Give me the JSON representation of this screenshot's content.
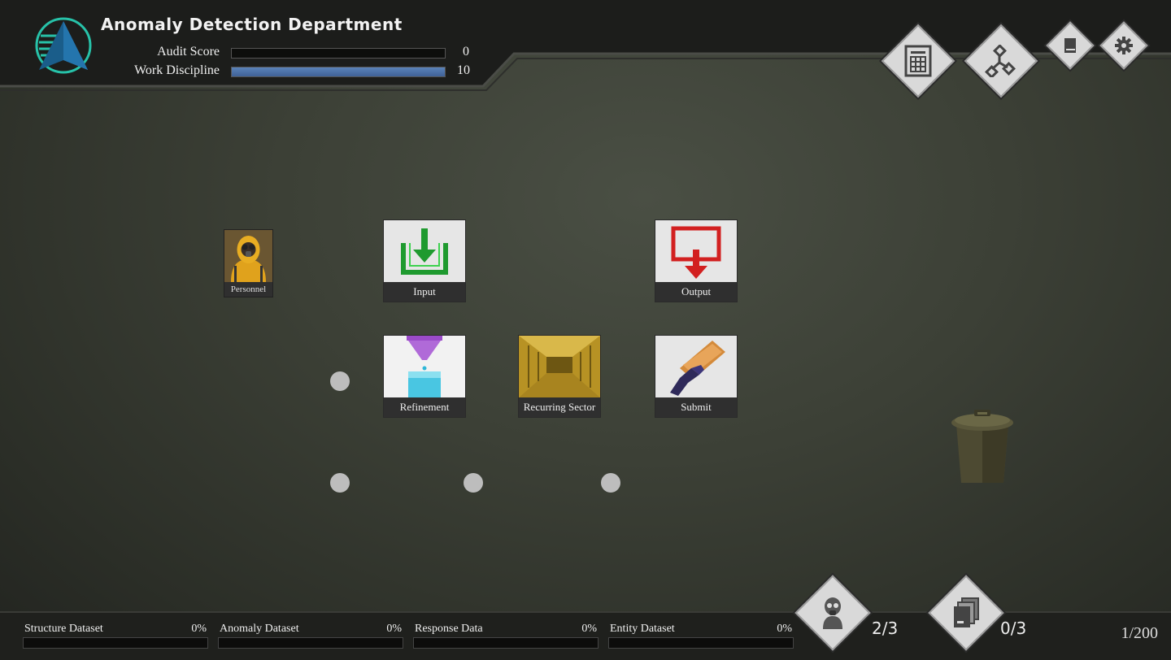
{
  "header": {
    "title": "Anomaly Detection Department",
    "stats": [
      {
        "label": "Audit Score",
        "value": "0",
        "fill": 0
      },
      {
        "label": "Work Discipline",
        "value": "10",
        "fill": 1
      }
    ]
  },
  "toolbar": {
    "buttons": [
      "document-grid-icon",
      "flowchart-icon",
      "book-icon",
      "gear-icon"
    ]
  },
  "board": {
    "personnel_label": "Personnel",
    "tiles": {
      "input": "Input",
      "output": "Output",
      "refinement": "Refinement",
      "recurring": "Recurring Sector",
      "submit": "Submit"
    }
  },
  "footer": {
    "datasets": [
      {
        "name": "Structure Dataset",
        "pct": "0%"
      },
      {
        "name": "Anomaly Dataset",
        "pct": "0%"
      },
      {
        "name": "Response Data",
        "pct": "0%"
      },
      {
        "name": "Entity Dataset",
        "pct": "0%"
      }
    ],
    "personnel_count": "2/3",
    "documents_count": "0/3",
    "page": "1/200"
  }
}
